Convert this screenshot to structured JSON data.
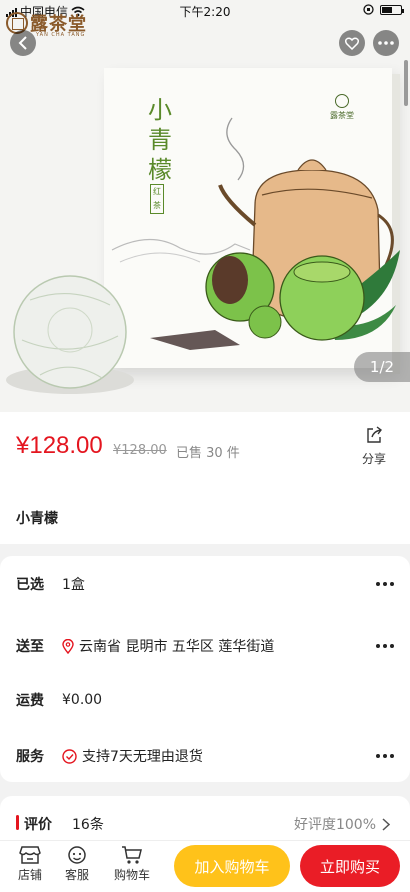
{
  "status_bar": {
    "carrier": "中国电信",
    "time": "下午2:20"
  },
  "brand": {
    "name": "露茶堂",
    "subtitle": "YAN CHA TANG"
  },
  "gallery": {
    "pager": "1/2",
    "box_title": "小青檬",
    "box_tag": "红茶",
    "box_brand": "露茶堂"
  },
  "product": {
    "price": "¥128.00",
    "original_price": "¥128.00",
    "sold": "已售 30 件",
    "share_label": "分享",
    "name": "小青檬"
  },
  "spec": {
    "selected_label": "已选",
    "selected_value": "1盒",
    "ship_label": "送至",
    "ship_value": "云南省 昆明市 五华区 莲华街道",
    "fee_label": "运费",
    "fee_value": "¥0.00",
    "service_label": "服务",
    "service_value": "支持7天无理由退货"
  },
  "review": {
    "label": "评价",
    "count": "16条",
    "rate": "好评度100%"
  },
  "bottom_bar": {
    "store": "店铺",
    "support": "客服",
    "cart": "购物车",
    "add_to_cart": "加入购物车",
    "buy_now": "立即购买"
  },
  "colors": {
    "price_red": "#e4151f",
    "cart_yellow": "#ffc21a",
    "buy_red": "#ea1d26"
  }
}
